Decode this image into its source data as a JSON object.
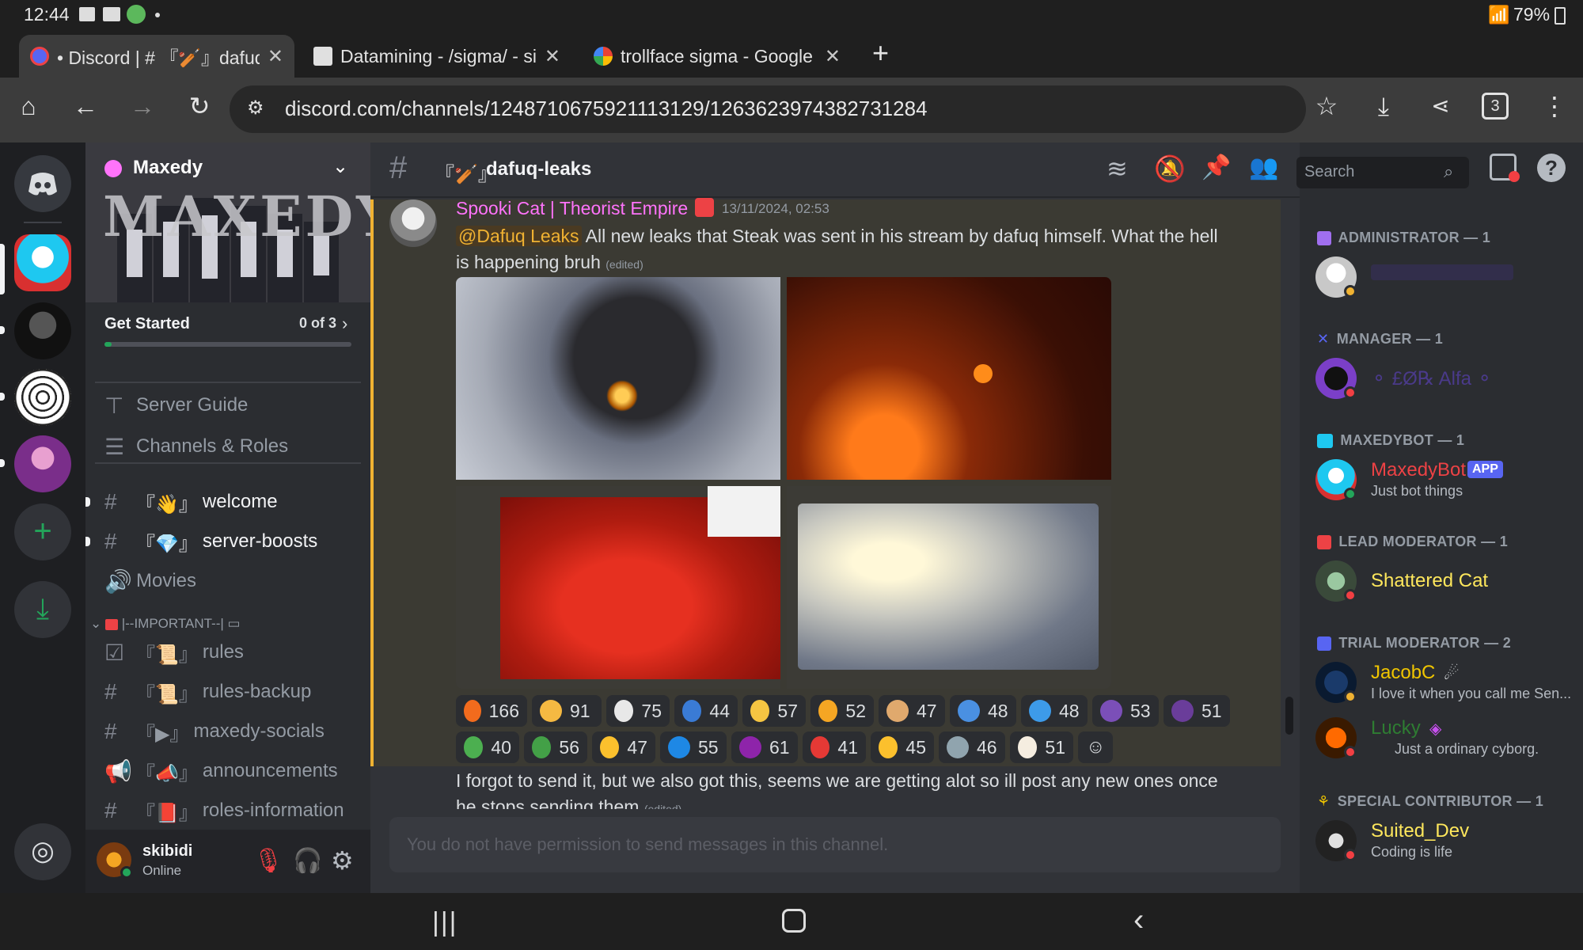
{
  "status": {
    "time": "12:44",
    "battery": "79%"
  },
  "tabs": [
    {
      "title": "• Discord | # 『🏏』dafuq",
      "close": "✕"
    },
    {
      "title": "Datamining - /sigma/ - si",
      "close": "✕"
    },
    {
      "title": "trollface sigma - Google S",
      "close": "✕"
    }
  ],
  "browser": {
    "url": "discord.com/channels/1248710675921113129/1263623974382731284",
    "tab_count": "3",
    "new_tab": "+"
  },
  "server": {
    "name": "Maxedy",
    "banner_text": "MAXEDY",
    "get_started": "Get Started",
    "progress_label": "0 of 3",
    "progress": 0.03,
    "nav": [
      "Server Guide",
      "Channels & Roles"
    ],
    "channels": [
      {
        "prefix": "『👋』",
        "name": "welcome",
        "type": "text",
        "unread": true
      },
      {
        "prefix": "『💎』",
        "name": "server-boosts",
        "type": "text",
        "unread": true
      },
      {
        "prefix": "",
        "name": "Movies",
        "type": "voice",
        "unread": false
      }
    ],
    "category": "|--IMPORTANT--|",
    "category_channels": [
      {
        "prefix": "『📜』",
        "name": "rules",
        "type": "rules"
      },
      {
        "prefix": "『📜』",
        "name": "rules-backup",
        "type": "text"
      },
      {
        "prefix": "『▶』",
        "name": "maxedy-socials",
        "type": "text"
      },
      {
        "prefix": "『📣』",
        "name": "announcements",
        "type": "announce"
      },
      {
        "prefix": "『📕』",
        "name": "roles-information",
        "type": "text"
      }
    ]
  },
  "user": {
    "name": "skibidi",
    "status": "Online"
  },
  "channel": {
    "prefix": "『🏏』",
    "name": "dafuq-leaks",
    "search_placeholder": "Search"
  },
  "message": {
    "author": "Spooki Cat | Theorist Empire",
    "timestamp": "13/11/2024, 02:53",
    "mention": "@Dafuq Leaks",
    "text_line1": "All new leaks that Steak was sent in his stream by dafuq himself. What the hell",
    "text_line2": "is happening bruh",
    "edited": "(edited)",
    "followup_line1": "I forgot to send it, but we also got this, seems we are getting alot so ill post any new ones once",
    "followup_line2": "he stops sending them",
    "followup_edited": "(edited)",
    "reactions": [
      {
        "emoji": "fire",
        "count": "166",
        "color": "#f26b1d"
      },
      {
        "emoji": "exploding-head",
        "count": "91",
        "color": "#f5b942"
      },
      {
        "emoji": "skull",
        "count": "75",
        "color": "#e8e8e8"
      },
      {
        "emoji": "blue-cap",
        "count": "44",
        "color": "#3a7bd5"
      },
      {
        "emoji": "screaming",
        "count": "57",
        "color": "#f5c542"
      },
      {
        "emoji": "cheese",
        "count": "52",
        "color": "#f5a623"
      },
      {
        "emoji": "technologist",
        "count": "47",
        "color": "#e0a96d"
      },
      {
        "emoji": "blue-face",
        "count": "48",
        "color": "#4a90e2"
      },
      {
        "emoji": "fish",
        "count": "48",
        "color": "#3d9be9"
      },
      {
        "emoji": "purple-demon",
        "count": "53",
        "color": "#7b4fb8"
      },
      {
        "emoji": "purple-creature",
        "count": "51",
        "color": "#6a3d9a"
      },
      {
        "emoji": "turtle",
        "count": "40",
        "color": "#4caf50"
      },
      {
        "emoji": "check-mark",
        "count": "56",
        "color": "#43a047"
      },
      {
        "emoji": "sunglasses",
        "count": "47",
        "color": "#fbc02d"
      },
      {
        "emoji": "letter-w",
        "count": "55",
        "color": "#1e88e5"
      },
      {
        "emoji": "purple-monster",
        "count": "61",
        "color": "#8e24aa"
      },
      {
        "emoji": "angry-face",
        "count": "41",
        "color": "#e53935"
      },
      {
        "emoji": "thumbs-up",
        "count": "45",
        "color": "#fbc02d"
      },
      {
        "emoji": "person-frame",
        "count": "46",
        "color": "#90a4ae"
      },
      {
        "emoji": "egg",
        "count": "51",
        "color": "#f5ede0"
      }
    ]
  },
  "composer": {
    "placeholder": "You do not have permission to send messages in this channel."
  },
  "members": [
    {
      "role": "ADMINISTRATOR — 1",
      "people": [
        {
          "name": "",
          "status": "",
          "color": "#5c3fa8"
        }
      ]
    },
    {
      "role": "MANAGER — 1",
      "people": [
        {
          "name": "⚬ £Ø℞ Alfa ⚬",
          "status": "",
          "color": "#5c3fa8"
        }
      ]
    },
    {
      "role": "MAXEDYBOT — 1",
      "people": [
        {
          "name": "MaxedyBot",
          "badge": "APP",
          "status": "Just bot things",
          "color": "#ed4245"
        }
      ]
    },
    {
      "role": "LEAD MODERATOR — 1",
      "people": [
        {
          "name": "Shattered Cat",
          "status": "",
          "color": "#fee75c"
        }
      ]
    },
    {
      "role": "TRIAL MODERATOR — 2",
      "people": [
        {
          "name": "JacobC",
          "status": "I love it when you call me Sen...",
          "color": "#f0c500"
        },
        {
          "name": "Lucky",
          "status": "Just a ordinary cyborg.",
          "color": "#2e7d32"
        }
      ]
    },
    {
      "role": "SPECIAL CONTRIBUTOR — 1",
      "people": [
        {
          "name": "Suited_Dev",
          "status": "Coding is life",
          "color": "#fee75c"
        }
      ]
    }
  ],
  "colors": {
    "accent": "#5865f2",
    "online": "#23a55a",
    "dnd": "#f23f43",
    "author": "#ff73fa",
    "mention_bg": "#4a3a22"
  }
}
